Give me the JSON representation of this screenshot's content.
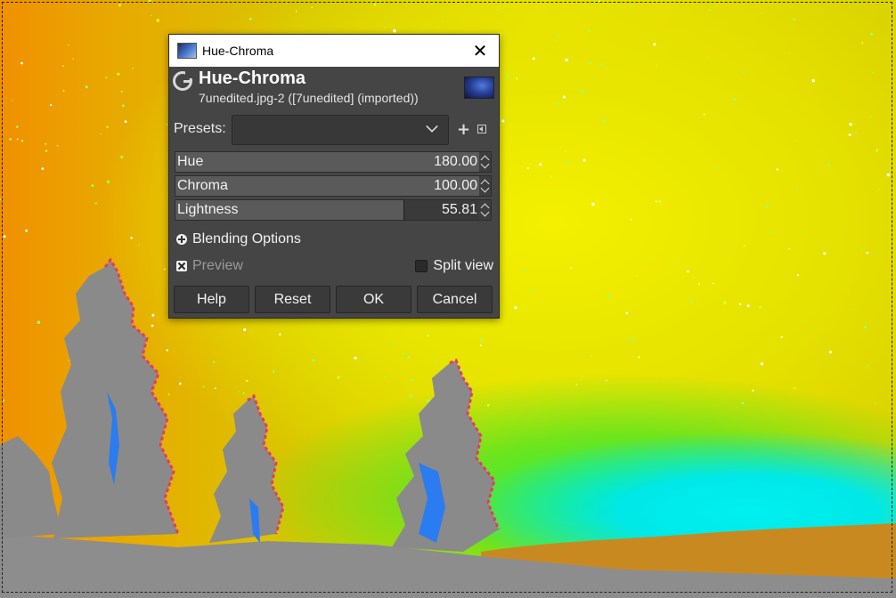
{
  "window": {
    "title": "Hue-Chroma",
    "close_glyph": "✕"
  },
  "header": {
    "title": "Hue-Chroma",
    "subtitle": "7unedited.jpg-2 ([7unedited] (imported))"
  },
  "presets": {
    "label": "Presets:",
    "value": "",
    "add_glyph": "+"
  },
  "sliders": [
    {
      "label": "Hue",
      "value": "180.00",
      "level": 1.0
    },
    {
      "label": "Chroma",
      "value": "100.00",
      "level": 1.0
    },
    {
      "label": "Lightness",
      "value": "55.81",
      "level": 0.75
    }
  ],
  "blending": {
    "label": "Blending Options"
  },
  "preview": {
    "label": "Preview",
    "checked": true
  },
  "split_view": {
    "label": "Split view",
    "checked": false
  },
  "buttons": {
    "help": "Help",
    "reset": "Reset",
    "ok": "OK",
    "cancel": "Cancel"
  },
  "icons": {
    "window_icon": "gimp-image-icon",
    "logo": "gimp-g-logo-icon",
    "preview_thumb": "image-thumbnail",
    "combo": "chevron-down-icon",
    "add": "plus-icon",
    "menu": "preset-menu-icon"
  }
}
